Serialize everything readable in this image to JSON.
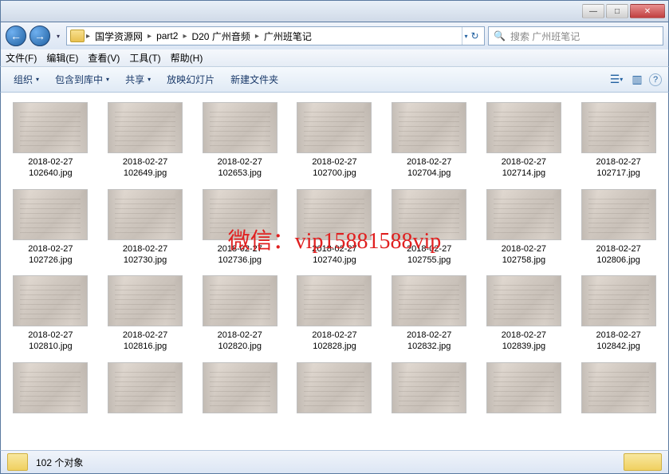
{
  "titlebar": {
    "min": "—",
    "max": "□",
    "close": "✕"
  },
  "nav": {
    "back": "←",
    "fwd": "→",
    "crumbs": [
      "国学资源网",
      "part2",
      "D20 广州音频",
      "广州班笔记"
    ],
    "dropdown": "▾",
    "refresh": "↻"
  },
  "search": {
    "placeholder": "搜索 广州班笔记",
    "icon": "🔍"
  },
  "menu": [
    "文件(F)",
    "编辑(E)",
    "查看(V)",
    "工具(T)",
    "帮助(H)"
  ],
  "toolbar": {
    "organize": "组织",
    "include": "包含到库中",
    "share": "共享",
    "slideshow": "放映幻灯片",
    "newfolder": "新建文件夹",
    "dd": "▾",
    "view_icon": "☰",
    "panel_icon": "▥",
    "help_icon": "?"
  },
  "files": [
    {
      "name": "2018-02-27 102640.jpg"
    },
    {
      "name": "2018-02-27 102649.jpg"
    },
    {
      "name": "2018-02-27 102653.jpg"
    },
    {
      "name": "2018-02-27 102700.jpg"
    },
    {
      "name": "2018-02-27 102704.jpg"
    },
    {
      "name": "2018-02-27 102714.jpg"
    },
    {
      "name": "2018-02-27 102717.jpg"
    },
    {
      "name": "2018-02-27 102726.jpg"
    },
    {
      "name": "2018-02-27 102730.jpg"
    },
    {
      "name": "2018-02-27 102736.jpg"
    },
    {
      "name": "2018-02-27 102740.jpg"
    },
    {
      "name": "2018-02-27 102755.jpg"
    },
    {
      "name": "2018-02-27 102758.jpg"
    },
    {
      "name": "2018-02-27 102806.jpg"
    },
    {
      "name": "2018-02-27 102810.jpg"
    },
    {
      "name": "2018-02-27 102816.jpg"
    },
    {
      "name": "2018-02-27 102820.jpg"
    },
    {
      "name": "2018-02-27 102828.jpg"
    },
    {
      "name": "2018-02-27 102832.jpg"
    },
    {
      "name": "2018-02-27 102839.jpg"
    },
    {
      "name": "2018-02-27 102842.jpg"
    },
    {
      "name": ""
    },
    {
      "name": ""
    },
    {
      "name": ""
    },
    {
      "name": ""
    },
    {
      "name": ""
    },
    {
      "name": ""
    },
    {
      "name": ""
    }
  ],
  "watermark": "微信：vip15881588vip",
  "status": {
    "count": "102 个对象"
  }
}
